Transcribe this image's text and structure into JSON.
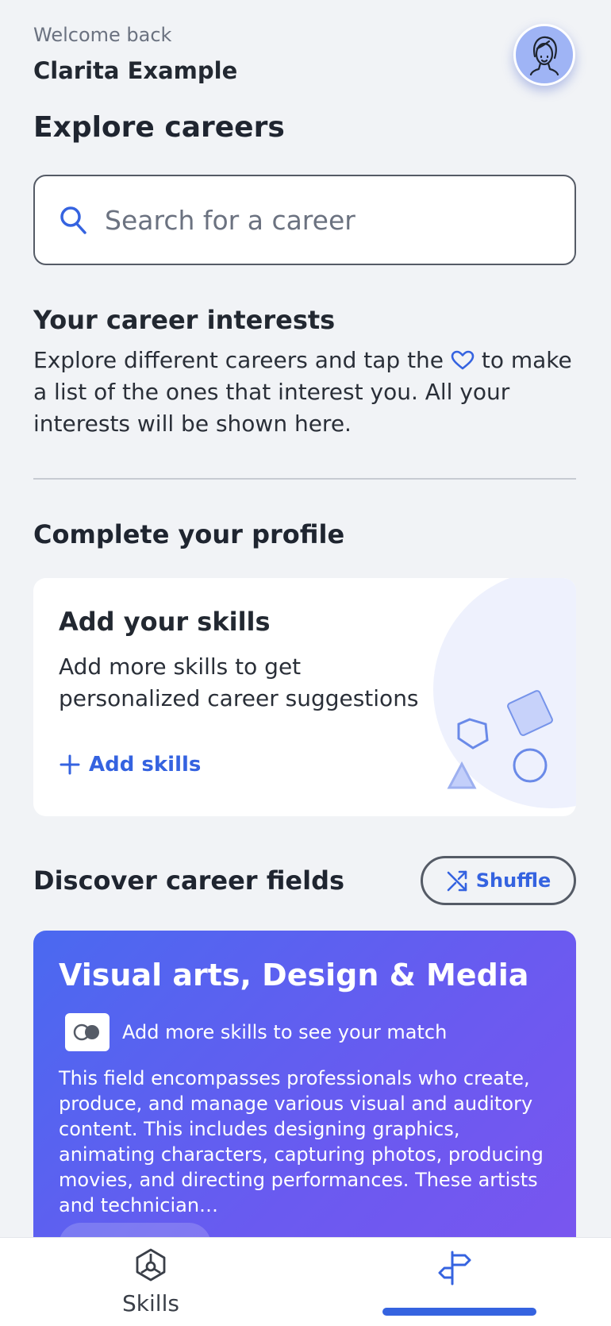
{
  "header": {
    "welcome": "Welcome back",
    "username": "Clarita Example"
  },
  "explore": {
    "title": "Explore careers",
    "search_placeholder": "Search for a career"
  },
  "interests": {
    "title": "Your career interests",
    "text_before": "Explore different careers and tap the",
    "text_after": "to make a list of the ones that interest you. All your interests will be shown here."
  },
  "profile": {
    "title": "Complete your profile",
    "card_title": "Add your skills",
    "card_text": "Add more skills to get personalized career suggestions",
    "action_label": "Add skills"
  },
  "discover": {
    "title": "Discover career fields",
    "shuffle_label": "Shuffle",
    "field": {
      "title": "Visual arts, Design & Media",
      "match_text": "Add more skills to see your match",
      "description": "This field encompasses professionals who create, produce, and manage various visual and auditory content. This includes designing graphics, animating characters, capturing photos, producing movies, and directing performances. These artists and technician…"
    }
  },
  "bottom_nav": {
    "skills_label": "Skills"
  },
  "colors": {
    "accent": "#3563e0",
    "background": "#f1f3f6",
    "card_gradient_start": "#4a69f0",
    "card_gradient_end": "#7a55ef"
  },
  "icons": [
    "avatar-icon",
    "search-icon",
    "heart-icon",
    "plus-icon",
    "shuffle-icon",
    "match-toggle-icon",
    "skills-icon",
    "careers-signpost-icon"
  ]
}
